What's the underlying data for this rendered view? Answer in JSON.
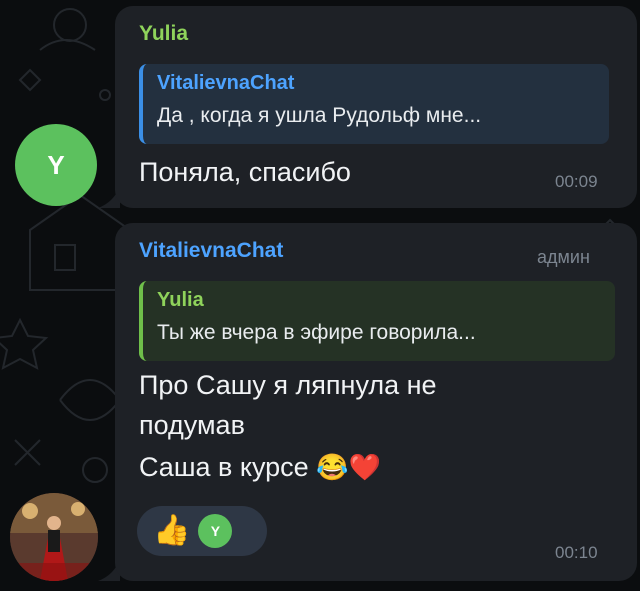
{
  "messages": [
    {
      "sender": "Yulia",
      "sender_color": "#8fd35b",
      "reply": {
        "name": "VitalievnaChat",
        "name_color": "#4da3ff",
        "text": "Да , когда я ушла  Рудольф мне...",
        "bg": "#23303f",
        "border_color": "#3b8fe6"
      },
      "text_lines": [
        "Поняла, спасибо"
      ],
      "time": "00:09",
      "avatar_letter": "Y",
      "avatar_color": "#5cc15e"
    },
    {
      "sender": "VitalievnaChat",
      "sender_color": "#4da3ff",
      "role": "админ",
      "reply": {
        "name": "Yulia",
        "name_color": "#8fd35b",
        "text": "Ты же вчера в эфире говорила...",
        "bg": "#253225",
        "border_color": "#6fbf4a"
      },
      "text_lines": [
        "Про Сашу я ляпнула не",
        "подумав",
        "Саша в курсе"
      ],
      "emojis": [
        "😂",
        "❤️"
      ],
      "reaction": {
        "emoji": "👍",
        "user_letter": "Y"
      },
      "time": "00:10"
    }
  ],
  "icons": [
    "thumbs-up-icon",
    "laughing-crying-icon",
    "red-heart-icon"
  ]
}
